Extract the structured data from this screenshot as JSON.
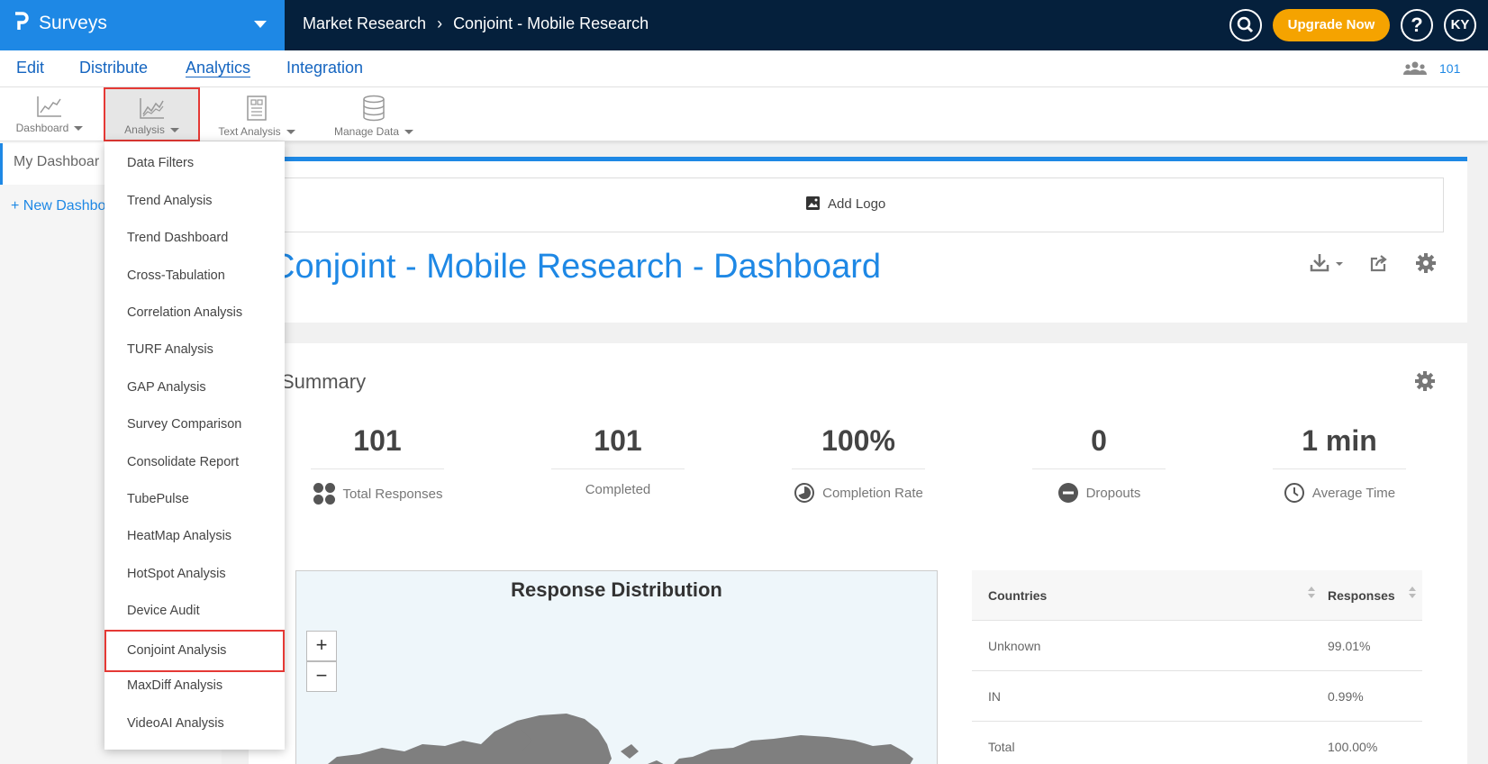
{
  "app": {
    "title": "Surveys"
  },
  "breadcrumb": {
    "parent": "Market Research",
    "current": "Conjoint - Mobile Research"
  },
  "header": {
    "upgrade_label": "Upgrade Now",
    "help_label": "?",
    "user_initials": "KY"
  },
  "nav": {
    "tabs": [
      {
        "label": "Edit"
      },
      {
        "label": "Distribute"
      },
      {
        "label": "Analytics",
        "active": true
      },
      {
        "label": "Integration"
      }
    ],
    "responses_count": "101"
  },
  "toolbar": {
    "items": [
      {
        "label": "Dashboard",
        "icon": "line-chart-icon"
      },
      {
        "label": "Analysis",
        "icon": "analysis-chart-icon",
        "selected": true
      },
      {
        "label": "Text Analysis",
        "icon": "text-analysis-icon"
      },
      {
        "label": "Manage Data",
        "icon": "database-icon"
      }
    ]
  },
  "sidebar": {
    "my_dashboard": "My Dashboar",
    "new_dashboard": "+ New Dashbo"
  },
  "analysis_menu": {
    "items": [
      {
        "label": "Data Filters"
      },
      {
        "label": "Trend Analysis"
      },
      {
        "label": "Trend Dashboard"
      },
      {
        "label": "Cross-Tabulation"
      },
      {
        "label": "Correlation Analysis"
      },
      {
        "label": "TURF Analysis"
      },
      {
        "label": "GAP Analysis"
      },
      {
        "label": "Survey Comparison"
      },
      {
        "label": "Consolidate Report"
      },
      {
        "label": "TubePulse"
      },
      {
        "label": "HeatMap Analysis"
      },
      {
        "label": "HotSpot Analysis"
      },
      {
        "label": "Device Audit"
      },
      {
        "label": "Conjoint Analysis",
        "highlighted": true
      },
      {
        "label": "MaxDiff Analysis"
      },
      {
        "label": "VideoAI Analysis"
      }
    ]
  },
  "dashboard": {
    "add_logo": "Add Logo",
    "title": "Conjoint - Mobile Research - Dashboard",
    "summary_title": "Summary",
    "stats": [
      {
        "value": "101",
        "label": "Total Responses",
        "icon": "grid-dots-icon"
      },
      {
        "value": "101",
        "label": "Completed",
        "icon": ""
      },
      {
        "value": "100%",
        "label": "Completion Rate",
        "icon": "pie-icon"
      },
      {
        "value": "0",
        "label": "Dropouts",
        "icon": "minus-circle-icon"
      },
      {
        "value": "1 min",
        "label": "Average Time",
        "icon": "clock-icon"
      }
    ],
    "map_title": "Response Distribution",
    "zoom_in": "+",
    "zoom_out": "−",
    "table": {
      "headers": [
        "Countries",
        "Responses"
      ],
      "rows": [
        [
          "Unknown",
          "99.01%"
        ],
        [
          "IN",
          "0.99%"
        ],
        [
          "Total",
          "100.00%"
        ]
      ]
    }
  },
  "colors": {
    "brand_blue": "#1e88e5",
    "topbar": "#05203c",
    "upgrade": "#f5a300",
    "highlight_red": "#e53935"
  }
}
